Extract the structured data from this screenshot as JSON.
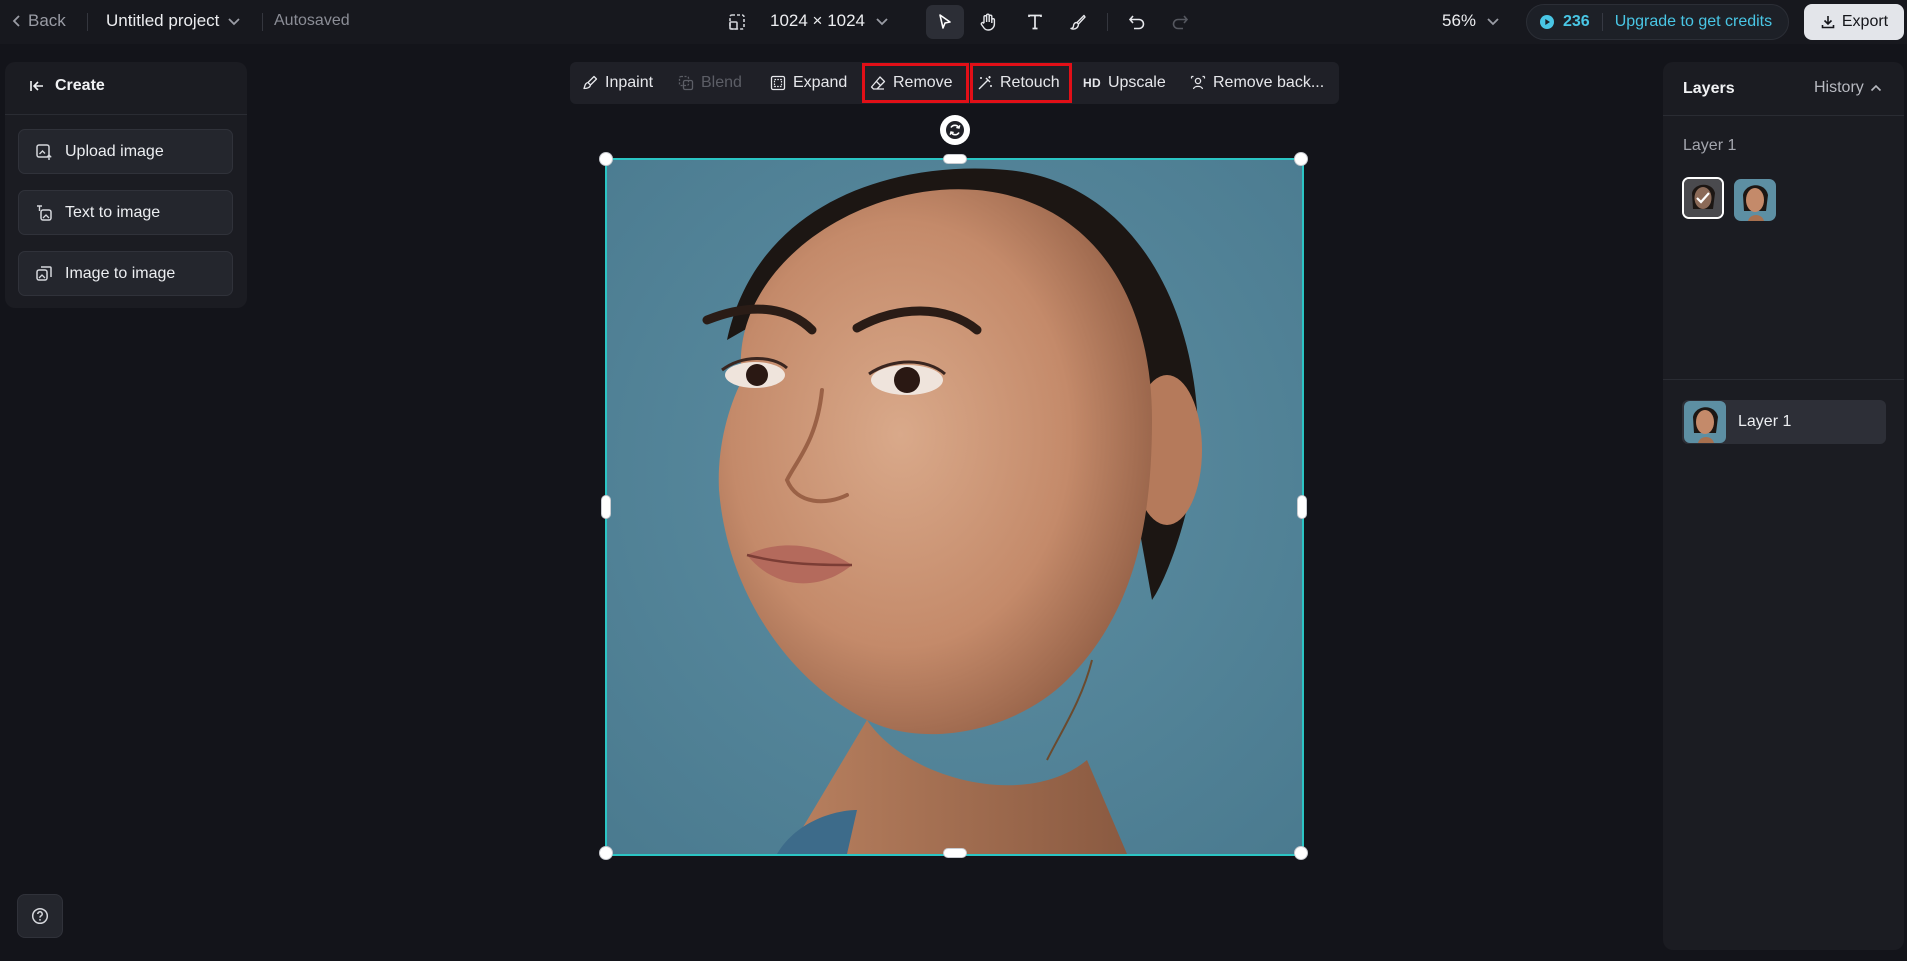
{
  "topbar": {
    "back_label": "Back",
    "project_name": "Untitled project",
    "save_status": "Autosaved",
    "canvas_size": "1024 × 1024",
    "zoom": "56%",
    "credits": "236",
    "upgrade_label": "Upgrade to get credits",
    "export_label": "Export"
  },
  "create_panel": {
    "title": "Create",
    "buttons": [
      {
        "label": "Upload image",
        "icon": "upload-image-icon"
      },
      {
        "label": "Text to image",
        "icon": "text-to-image-icon"
      },
      {
        "label": "Image to image",
        "icon": "image-to-image-icon"
      }
    ]
  },
  "canvas_toolbar": {
    "inpaint": "Inpaint",
    "blend": "Blend",
    "expand": "Expand",
    "remove": "Remove",
    "retouch": "Retouch",
    "upscale_badge": "HD",
    "upscale": "Upscale",
    "remove_background": "Remove back..."
  },
  "layers_panel": {
    "title": "Layers",
    "history_label": "History",
    "group_label": "Layer 1",
    "layer_name": "Layer 1"
  },
  "colors": {
    "background": "#13141a",
    "accent": "#49c6e5",
    "selection": "#2bc5c4",
    "highlight": "#e10f17"
  }
}
